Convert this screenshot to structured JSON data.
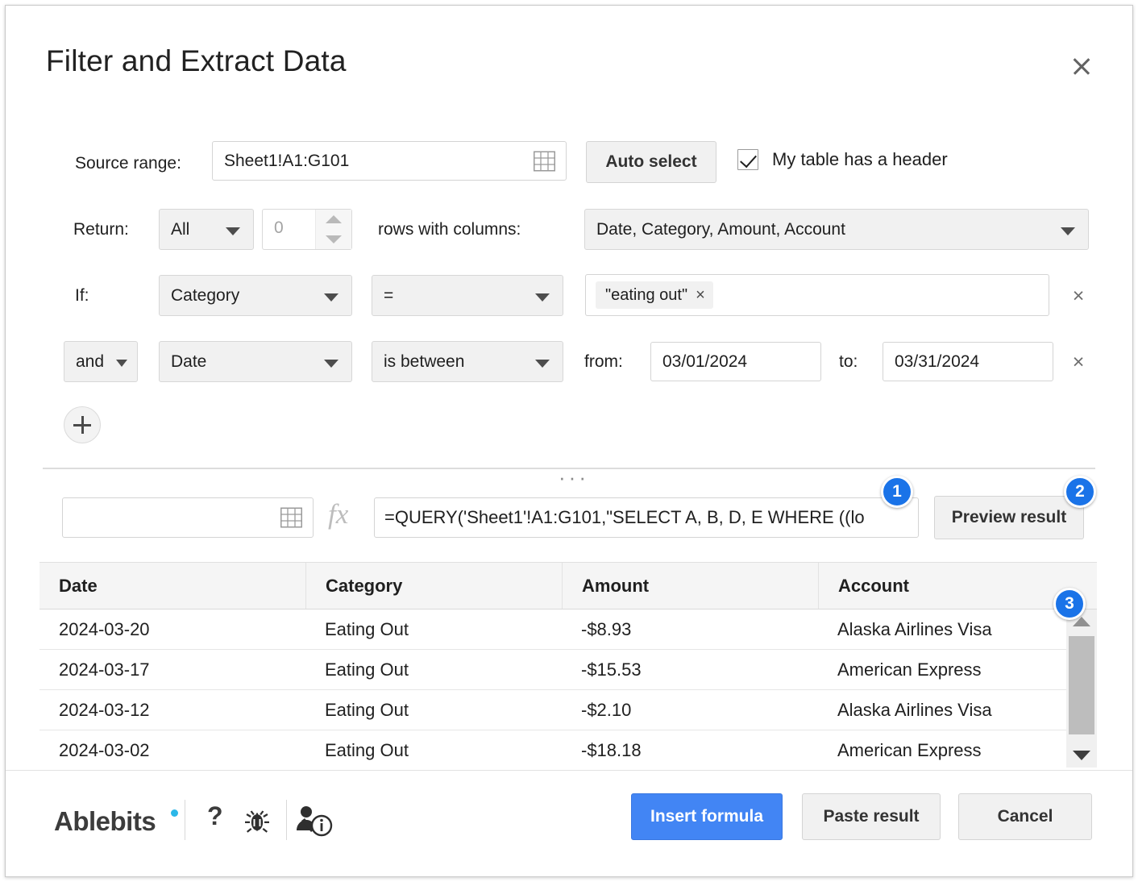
{
  "dialog": {
    "title": "Filter and Extract Data",
    "close_icon": "close-icon"
  },
  "source": {
    "label": "Source range:",
    "value": "Sheet1!A1:G101",
    "picker_icon": "range-picker-grid-icon",
    "auto_select": "Auto select",
    "header_checkbox_label": "My table has a header",
    "header_checkbox_checked": true
  },
  "return_row": {
    "label": "Return:",
    "mode": "All",
    "count_value": "0",
    "rows_label": "rows with columns:",
    "columns_value": "Date, Category, Amount, Account"
  },
  "conditions": {
    "if_label": "If:",
    "rows": [
      {
        "field": "Category",
        "operator": "=",
        "chip": "\"eating out\"",
        "chip_remove": "×",
        "remove": "×"
      },
      {
        "conjunction": "and",
        "field": "Date",
        "operator": "is between",
        "from_label": "from:",
        "from_value": "03/01/2024",
        "to_label": "to:",
        "to_value": "03/31/2024",
        "remove": "×"
      }
    ],
    "add_icon": "plus-icon"
  },
  "formula_bar": {
    "drag_handle": "···",
    "destination_value": "",
    "destination_picker_icon": "range-picker-grid-icon",
    "fx_label": "fx",
    "formula": "=QUERY('Sheet1'!A1:G101,\"SELECT A, B, D, E WHERE ((lo",
    "preview_button": "Preview result"
  },
  "badges": [
    {
      "number": "1"
    },
    {
      "number": "2"
    },
    {
      "number": "3"
    }
  ],
  "results": {
    "columns": [
      "Date",
      "Category",
      "Amount",
      "Account"
    ],
    "rows": [
      [
        "2024-03-20",
        "Eating Out",
        "-$8.93",
        "Alaska Airlines Visa"
      ],
      [
        "2024-03-17",
        "Eating Out",
        "-$15.53",
        "American Express"
      ],
      [
        "2024-03-12",
        "Eating Out",
        "-$2.10",
        "Alaska Airlines Visa"
      ],
      [
        "2024-03-02",
        "Eating Out",
        "-$18.18",
        "American Express"
      ]
    ],
    "scroll_up_icon": "scroll-up-arrow-icon",
    "scroll_down_icon": "scroll-down-arrow-icon"
  },
  "footer": {
    "brand": "Ablebits",
    "help_icon": "question-mark-icon",
    "bug_icon": "bug-icon",
    "account_icon": "account-info-icon",
    "insert_formula": "Insert formula",
    "paste_result": "Paste result",
    "cancel": "Cancel"
  },
  "colors": {
    "accent_blue": "#4285f4",
    "badge_blue": "#1a73e8",
    "logo_dot": "#2bb7e8"
  }
}
